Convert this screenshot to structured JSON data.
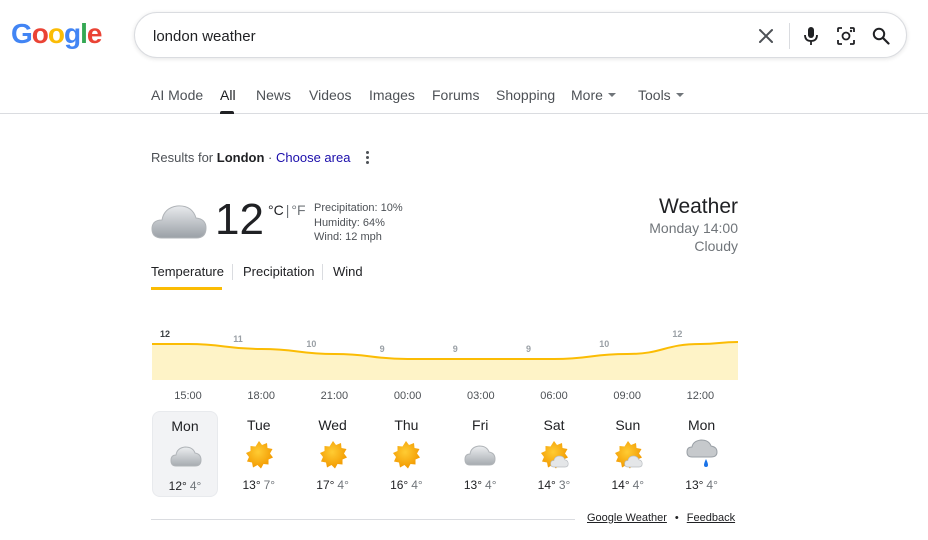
{
  "logo": {
    "letters": [
      "G",
      "o",
      "o",
      "g",
      "l",
      "e"
    ],
    "colors": [
      "#4285f4",
      "#ea4335",
      "#fbbc05",
      "#4285f4",
      "#34a853",
      "#ea4335"
    ]
  },
  "search": {
    "value": "london weather"
  },
  "tabs": [
    {
      "label": "AI Mode"
    },
    {
      "label": "All"
    },
    {
      "label": "News"
    },
    {
      "label": "Videos"
    },
    {
      "label": "Images"
    },
    {
      "label": "Forums"
    },
    {
      "label": "Shopping"
    },
    {
      "label": "More"
    },
    {
      "label": "Tools"
    }
  ],
  "results": {
    "prefix": "Results for",
    "location": "London",
    "separator": "·",
    "choose": "Choose area"
  },
  "current": {
    "temp": "12",
    "unit_c": "°C",
    "unit_sep": "|",
    "unit_f": "°F",
    "precipitation": "Precipitation: 10%",
    "humidity": "Humidity: 64%",
    "wind": "Wind: 12 mph",
    "title": "Weather",
    "day_time": "Monday 14:00",
    "condition": "Cloudy",
    "icon": "cloud-icon"
  },
  "subtabs": [
    {
      "label": "Temperature"
    },
    {
      "label": "Precipitation"
    },
    {
      "label": "Wind"
    }
  ],
  "chart_data": {
    "type": "area",
    "x": [
      "15:00",
      "18:00",
      "21:00",
      "00:00",
      "03:00",
      "06:00",
      "09:00",
      "12:00"
    ],
    "series": [
      {
        "values": [
          12,
          11,
          10,
          9,
          9,
          9,
          10,
          12
        ]
      }
    ],
    "labels": [
      "12",
      "11",
      "10",
      "9",
      "9",
      "9",
      "10",
      "12"
    ],
    "colors": {
      "line": "#fbbc04",
      "fill": "#fef3c7"
    }
  },
  "days": [
    {
      "name": "Mon",
      "hi": "12°",
      "lo": "4°",
      "icon": "cloud-icon"
    },
    {
      "name": "Tue",
      "hi": "13°",
      "lo": "7°",
      "icon": "sun-icon"
    },
    {
      "name": "Wed",
      "hi": "17°",
      "lo": "4°",
      "icon": "sun-icon"
    },
    {
      "name": "Thu",
      "hi": "16°",
      "lo": "4°",
      "icon": "sun-icon"
    },
    {
      "name": "Fri",
      "hi": "13°",
      "lo": "4°",
      "icon": "cloud-icon"
    },
    {
      "name": "Sat",
      "hi": "14°",
      "lo": "3°",
      "icon": "partly-cloudy-icon"
    },
    {
      "name": "Sun",
      "hi": "14°",
      "lo": "4°",
      "icon": "partly-cloudy-icon"
    },
    {
      "name": "Mon",
      "hi": "13°",
      "lo": "4°",
      "icon": "rain-icon"
    }
  ],
  "footer": {
    "source": "Google Weather",
    "dot": "•",
    "feedback": "Feedback"
  }
}
